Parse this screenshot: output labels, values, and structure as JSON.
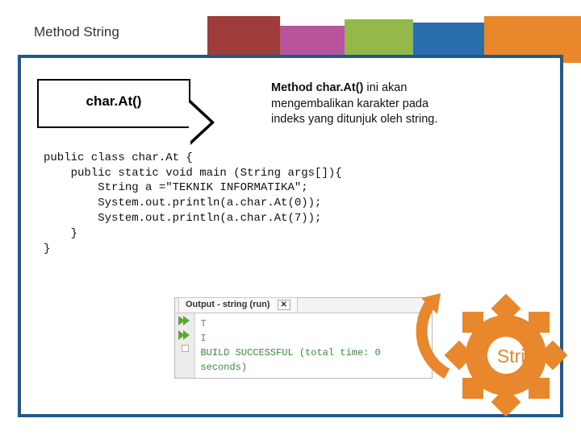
{
  "slide": {
    "title": "Method String",
    "method_name": "char.At()",
    "description_bold": "Method char.At()",
    "description_rest": " ini akan mengembalikan karakter pada indeks yang ditunjuk oleh string.",
    "code": "public class char.At {\n    public static void main (String args[]){\n        String a =\"TEKNIK INFORMATIKA\";\n        System.out.println(a.char.At(0));\n        System.out.println(a.char.At(7));\n    }\n}",
    "output": {
      "tab_label": "Output - string (run)",
      "lines": [
        "T",
        "I"
      ],
      "build_msg": "BUILD SUCCESSFUL (total time: 0 seconds)"
    },
    "gear_label": "String"
  },
  "colors": {
    "frame": "#1e5a8d",
    "orange": "#e8872b"
  }
}
